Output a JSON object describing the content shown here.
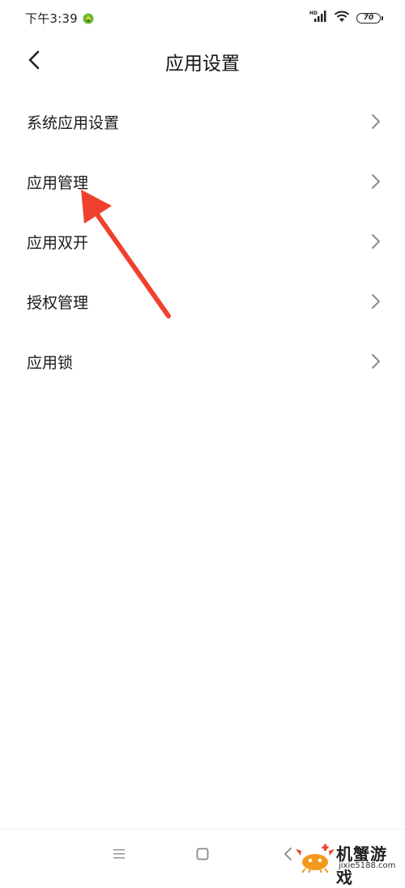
{
  "status_bar": {
    "time": "下午3:39",
    "battery": "70",
    "network_badge": "HD"
  },
  "header": {
    "title": "应用设置"
  },
  "list": {
    "items": [
      {
        "label": "系统应用设置"
      },
      {
        "label": "应用管理"
      },
      {
        "label": "应用双开"
      },
      {
        "label": "授权管理"
      },
      {
        "label": "应用锁"
      }
    ]
  },
  "watermark": {
    "title": "机蟹游戏",
    "url": "jixie5188.com"
  },
  "colors": {
    "annotation_arrow": "#f0412e",
    "status_app_icon": "#6ab82e",
    "text": "#1a1a1a",
    "chevron": "#8a8a8a"
  },
  "icons": {
    "back": "chevron-left-icon",
    "item_arrow": "chevron-right-icon",
    "nav_menu": "menu-icon",
    "nav_home": "square-icon",
    "nav_back": "triangle-back-icon"
  }
}
